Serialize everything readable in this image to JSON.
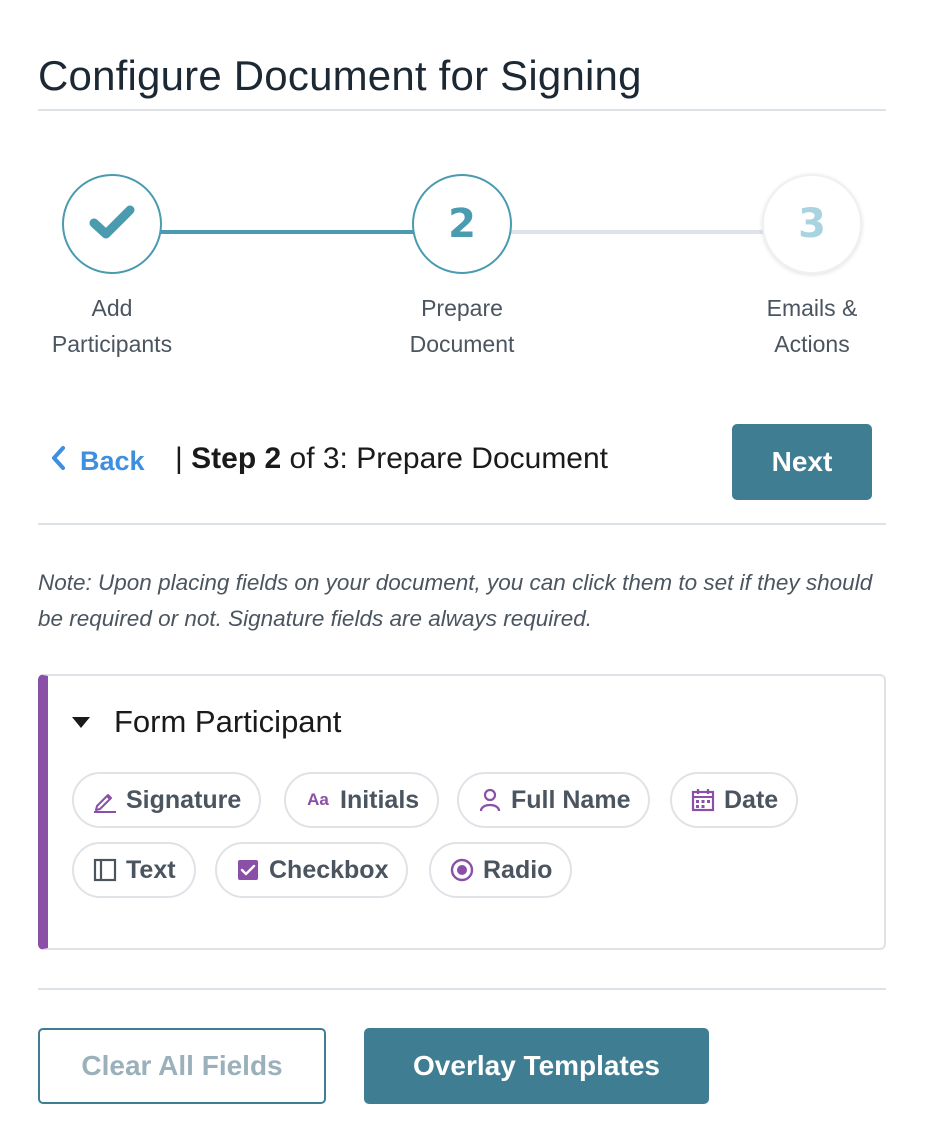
{
  "page": {
    "title": "Configure Document for Signing"
  },
  "stepper": {
    "steps": [
      {
        "number": "",
        "icon": "checkmark-icon",
        "label_line1": "Add",
        "label_line2": "Participants",
        "state": "completed"
      },
      {
        "number": "2",
        "label_line1": "Prepare",
        "label_line2": "Document",
        "state": "current"
      },
      {
        "number": "3",
        "label_line1": "Emails &",
        "label_line2": "Actions",
        "state": "upcoming"
      }
    ]
  },
  "nav": {
    "back_label": "Back",
    "step_prefix": "| ",
    "step_bold": "Step 2",
    "step_rest": " of 3: Prepare Document",
    "next_label": "Next"
  },
  "note": "Note: Upon placing fields on your document, you can click them to set if they should be required or not. Signature fields are always required.",
  "participant": {
    "name": "Form Participant",
    "fields": [
      {
        "label": "Signature",
        "icon": "pen-icon"
      },
      {
        "label": "Initials",
        "icon": "initials-icon",
        "icon_text": "Aa"
      },
      {
        "label": "Full Name",
        "icon": "person-icon"
      },
      {
        "label": "Date",
        "icon": "calendar-icon"
      },
      {
        "label": "Text",
        "icon": "text-box-icon"
      },
      {
        "label": "Checkbox",
        "icon": "checkbox-icon"
      },
      {
        "label": "Radio",
        "icon": "radio-icon"
      }
    ]
  },
  "footer": {
    "clear_label": "Clear All Fields",
    "overlay_label": "Overlay Templates"
  },
  "colors": {
    "primary": "#3f7e92",
    "accent_purple": "#8a4fa6",
    "link_blue": "#3d8fe0",
    "step_teal": "#4a9ab0",
    "step_upcoming": "#a9d3de"
  }
}
